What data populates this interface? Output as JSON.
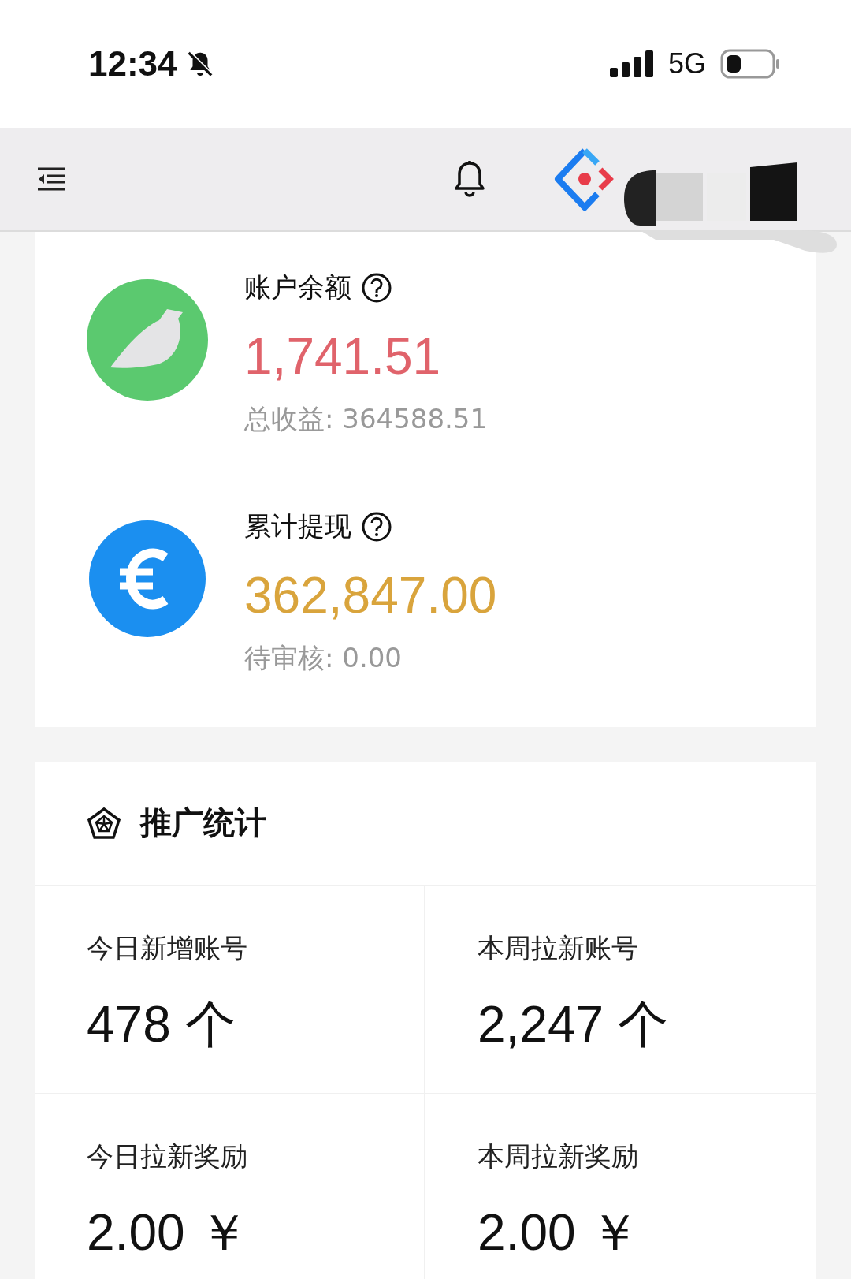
{
  "status_bar": {
    "time": "12:34",
    "network": "5G"
  },
  "balances": [
    {
      "kind": "bird",
      "label": "账户余额",
      "amount": "1,741.51",
      "color": "#e0636b",
      "sub": "总收益: 364588.51"
    },
    {
      "kind": "euro",
      "label": "累计提现",
      "amount": "362,847.00",
      "color": "#d9a43c",
      "sub": "待审核: 0.00"
    }
  ],
  "stats": {
    "title": "推广统计",
    "cells": [
      {
        "label": "今日新增账号",
        "value": "478 个"
      },
      {
        "label": "本周拉新账号",
        "value": "2,247 个"
      },
      {
        "label": "今日拉新奖励",
        "value": "2.00 ￥"
      },
      {
        "label": "本周拉新奖励",
        "value": "2.00 ￥"
      }
    ]
  }
}
